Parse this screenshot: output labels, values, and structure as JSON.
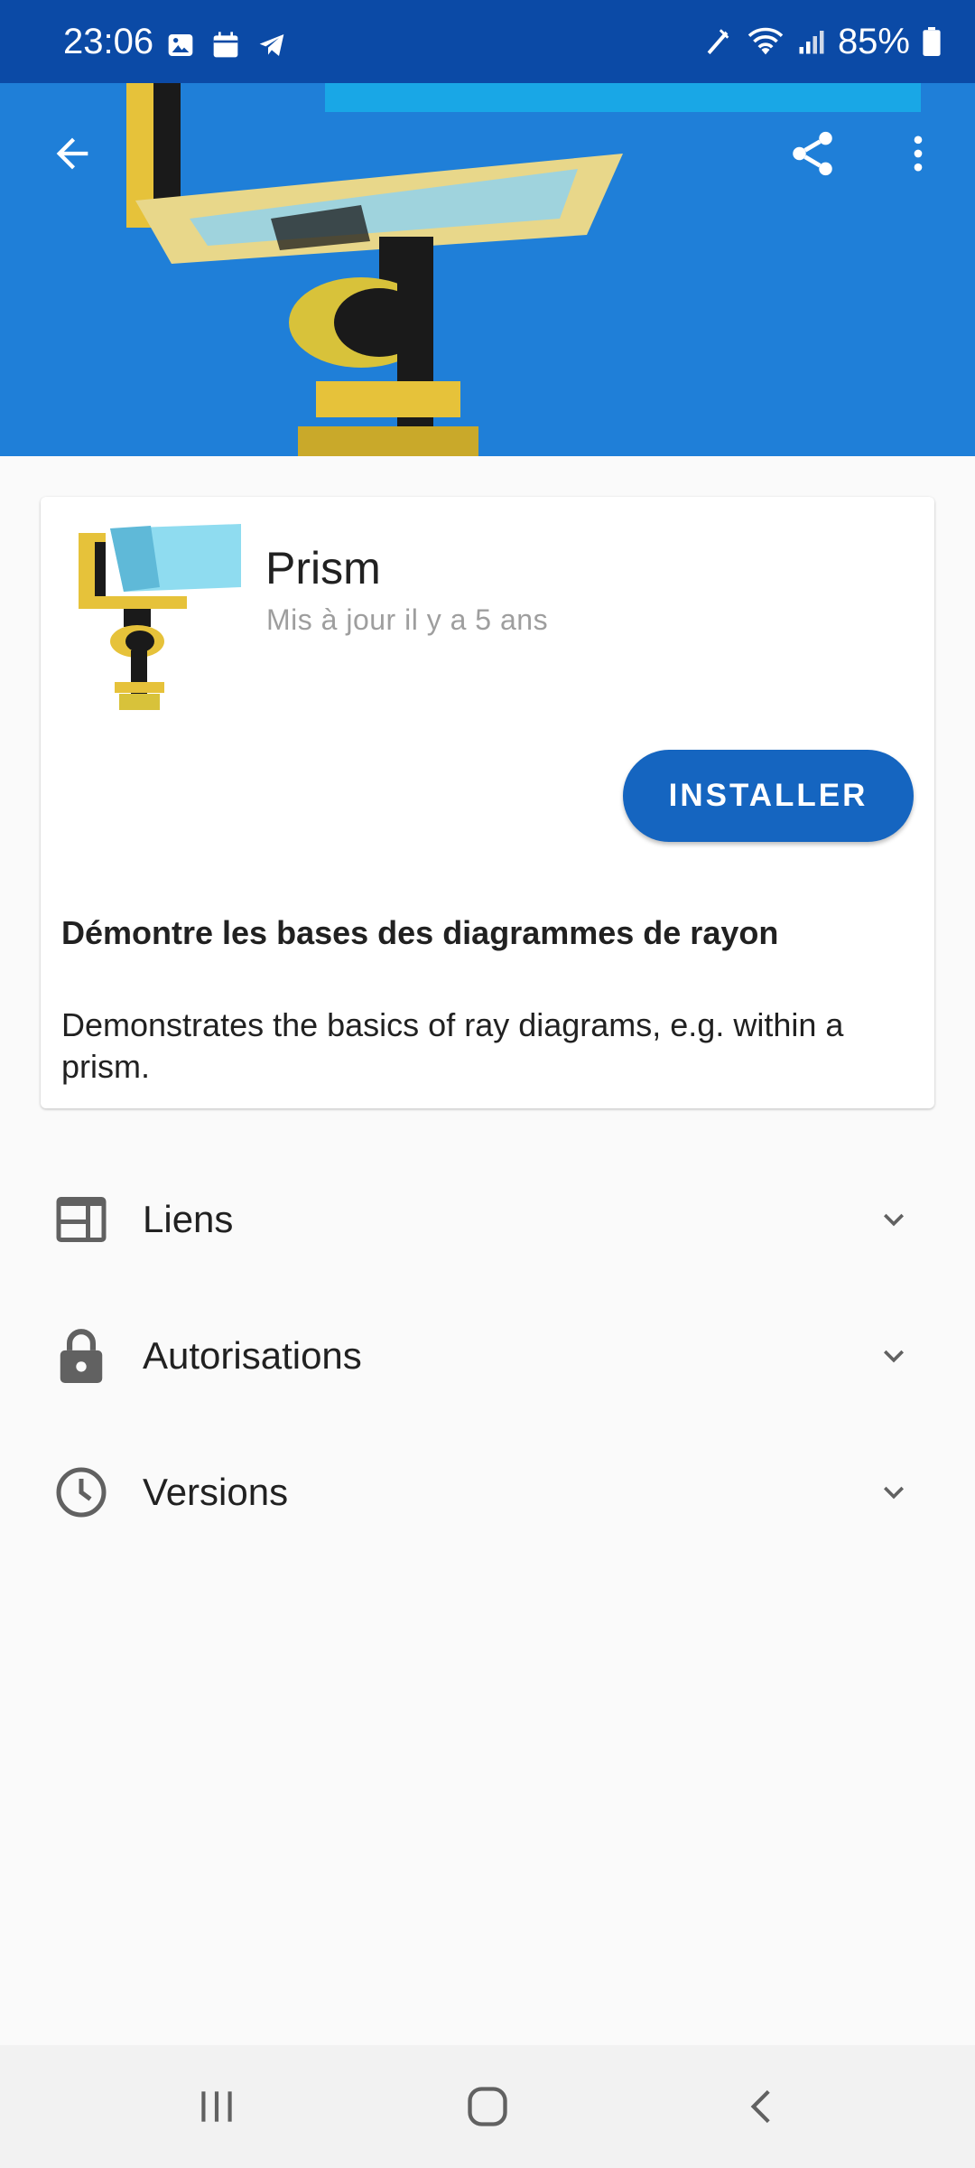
{
  "status_bar": {
    "time": "23:06",
    "battery": "85%",
    "left_icons": [
      "gallery-icon",
      "calendar-icon",
      "telegram-icon"
    ],
    "right_icons": [
      "nfc-icon",
      "wifi-icon",
      "signal-icon",
      "battery-icon"
    ]
  },
  "app_bar": {
    "back_icon": "arrow-back-icon",
    "share_icon": "share-icon",
    "menu_icon": "more-vert-icon"
  },
  "app": {
    "name": "Prism",
    "updated": "Mis à jour il y a 5 ans",
    "install_label": "INSTALLER",
    "summary": "Démontre les bases des diagrammes de rayon",
    "description": "Demonstrates the basics of ray diagrams, e.g. within a prism."
  },
  "sections": [
    {
      "label": "Liens",
      "icon": "web-icon"
    },
    {
      "label": "Autorisations",
      "icon": "lock-icon"
    },
    {
      "label": "Versions",
      "icon": "clock-icon"
    }
  ],
  "colors": {
    "status_bar": "#0b4aa6",
    "hero": "#1f7fd8",
    "accent": "#1565c0",
    "secondary_text": "#9e9e9e",
    "icon_grey": "#616161"
  },
  "nav_bar": [
    "recents-icon",
    "home-icon",
    "back-icon"
  ]
}
